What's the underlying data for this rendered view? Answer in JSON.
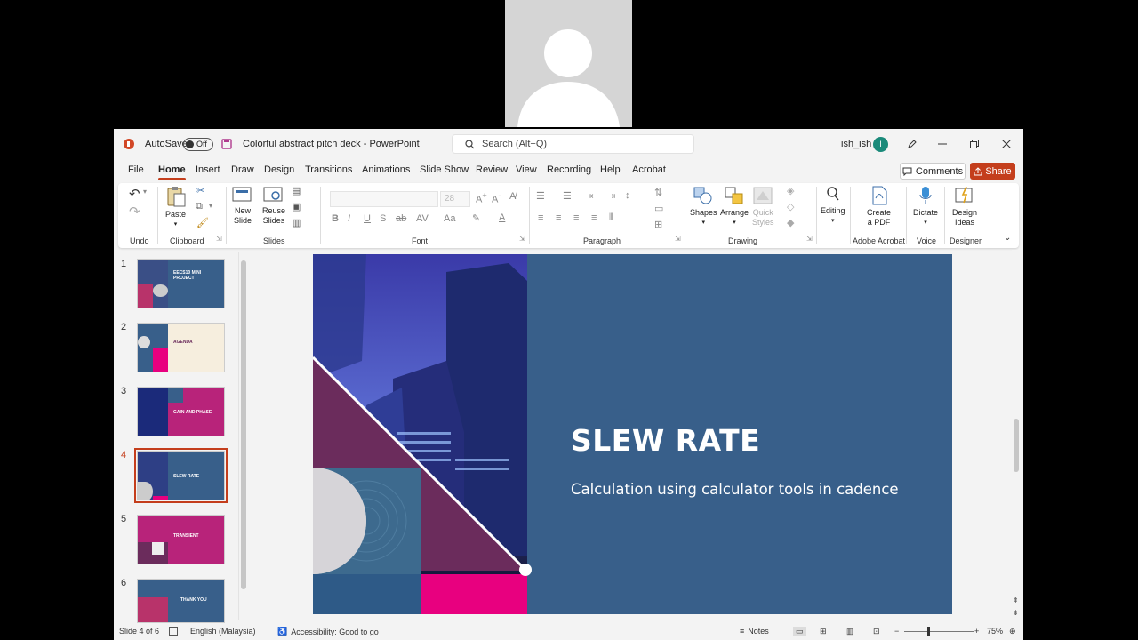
{
  "app": {
    "autosave_label": "AutoSave",
    "autosave_state": "Off",
    "doc_title": "Colorful abstract pitch deck",
    "app_name": "PowerPoint",
    "search_placeholder": "Search (Alt+Q)",
    "user_name": "ish_ish",
    "user_initial": "I"
  },
  "menus": [
    "File",
    "Home",
    "Insert",
    "Draw",
    "Design",
    "Transitions",
    "Animations",
    "Slide Show",
    "Review",
    "View",
    "Recording",
    "Help",
    "Acrobat"
  ],
  "menu_active": "Home",
  "actions": {
    "comments": "Comments",
    "share": "Share"
  },
  "ribbon": {
    "groups": [
      "Undo",
      "Clipboard",
      "Slides",
      "Font",
      "Paragraph",
      "Drawing",
      "Adobe Acrobat",
      "Voice",
      "Designer"
    ],
    "paste": "Paste",
    "new_slide": [
      "New",
      "Slide"
    ],
    "reuse_slides": [
      "Reuse",
      "Slides"
    ],
    "font_size": "28",
    "shapes": "Shapes",
    "arrange": "Arrange",
    "quick_styles": [
      "Quick",
      "Styles"
    ],
    "editing": "Editing",
    "create_pdf": [
      "Create",
      "a PDF"
    ],
    "dictate": "Dictate",
    "design_ideas": [
      "Design",
      "Ideas"
    ]
  },
  "thumbnails": [
    {
      "num": "1",
      "title": "EECS10 MINI PROJECT"
    },
    {
      "num": "2",
      "title": "AGENDA"
    },
    {
      "num": "3",
      "title": "GAIN AND PHASE"
    },
    {
      "num": "4",
      "title": "SLEW RATE"
    },
    {
      "num": "5",
      "title": "TRANSIENT"
    },
    {
      "num": "6",
      "title": "THANK YOU"
    }
  ],
  "selected_slide": 4,
  "slide": {
    "title": "SLEW RATE",
    "subtitle": "Calculation using calculator tools in cadence"
  },
  "status": {
    "slide_info": "Slide 4 of 6",
    "language": "English (Malaysia)",
    "accessibility": "Accessibility: Good to go",
    "notes": "Notes",
    "zoom": "75%"
  },
  "colors": {
    "accent": "#c43e1c",
    "slide_blue": "#385f8a",
    "magenta": "#e8007f",
    "plum": "#6b2c5c"
  }
}
